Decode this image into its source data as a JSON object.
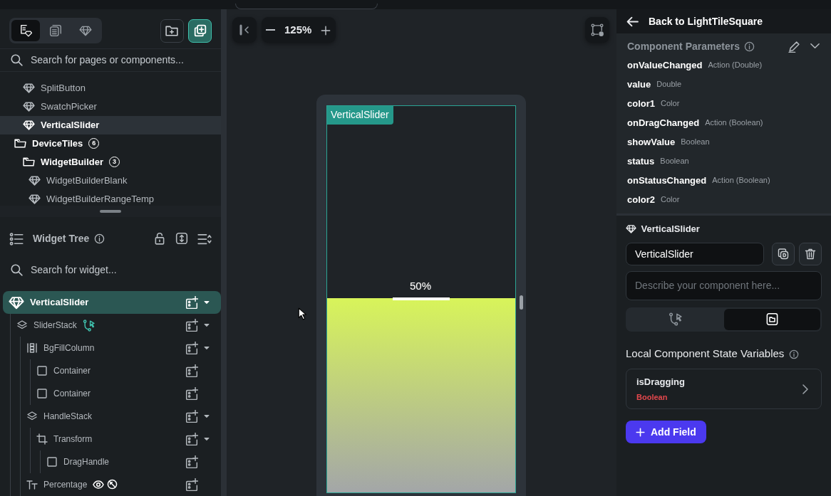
{
  "left_panel": {
    "mode_tabs": [
      {
        "kind": "pages-components",
        "selected": true
      },
      {
        "kind": "pages",
        "selected": false
      },
      {
        "kind": "components",
        "selected": false
      }
    ],
    "search": {
      "placeholder": "Search for pages or components..."
    },
    "items": [
      {
        "kind": "component",
        "label": "SplitButton",
        "selected": false
      },
      {
        "kind": "component",
        "label": "SwatchPicker",
        "selected": false
      },
      {
        "kind": "component",
        "label": "VerticalSlider",
        "selected": true
      },
      {
        "kind": "folder",
        "label": "DeviceTiles",
        "count": "6",
        "selected": false,
        "children": [
          {
            "kind": "folder",
            "label": "WidgetBuilder",
            "count": "3",
            "selected": false,
            "children": [
              {
                "kind": "component",
                "label": "WidgetBuilderBlank",
                "selected": false
              },
              {
                "kind": "component",
                "label": "WidgetBuilderRangeTemp",
                "selected": false
              }
            ]
          }
        ]
      }
    ]
  },
  "widget_tree": {
    "title": "Widget Tree",
    "search": {
      "placeholder": "Search for widget..."
    },
    "nodes": [
      {
        "kind": "component",
        "label": "VerticalSlider",
        "selected": true,
        "children": [
          {
            "kind": "stack",
            "label": "SliderStack",
            "has_logic": true,
            "selected": false,
            "children": [
              {
                "kind": "column",
                "label": "BgFillColumn",
                "selected": false,
                "children": [
                  {
                    "kind": "container",
                    "label": "Container",
                    "selected": false
                  },
                  {
                    "kind": "container",
                    "label": "Container",
                    "selected": false
                  }
                ]
              },
              {
                "kind": "stack",
                "label": "HandleStack",
                "selected": false,
                "children": [
                  {
                    "kind": "transform",
                    "label": "Transform",
                    "selected": false,
                    "children": [
                      {
                        "kind": "container",
                        "label": "DragHandle",
                        "selected": false
                      }
                    ]
                  }
                ]
              },
              {
                "kind": "text",
                "label": "Percentage",
                "conditional_visibility": true,
                "selected": false
              }
            ]
          }
        ]
      }
    ]
  },
  "canvas": {
    "zoom": "125%",
    "frame_label": "VerticalSlider",
    "slider": {
      "level": 0.5,
      "value_label": "50%"
    }
  },
  "right_panel": {
    "back_link": "Back to LightTileSquare",
    "parameters": {
      "title": "Component Parameters",
      "items": [
        {
          "name": "onValueChanged",
          "type": "Action (Double)"
        },
        {
          "name": "value",
          "type": "Double"
        },
        {
          "name": "color1",
          "type": "Color"
        },
        {
          "name": "onDragChanged",
          "type": "Action (Boolean)"
        },
        {
          "name": "showValue",
          "type": "Boolean"
        },
        {
          "name": "status",
          "type": "Boolean"
        },
        {
          "name": "onStatusChanged",
          "type": "Action (Boolean)"
        },
        {
          "name": "color2",
          "type": "Color"
        }
      ]
    },
    "component": {
      "title": "VerticalSlider",
      "name_value": "VerticalSlider",
      "description": {
        "placeholder": "Describe your component here..."
      },
      "view_toggle": [
        {
          "kind": "logic",
          "selected": false
        },
        {
          "kind": "file",
          "selected": true
        }
      ]
    },
    "state_variables": {
      "title": "Local Component State Variables",
      "items": [
        {
          "name": "isDragging",
          "type": "Boolean"
        }
      ],
      "add_button": "Add Field"
    }
  }
}
